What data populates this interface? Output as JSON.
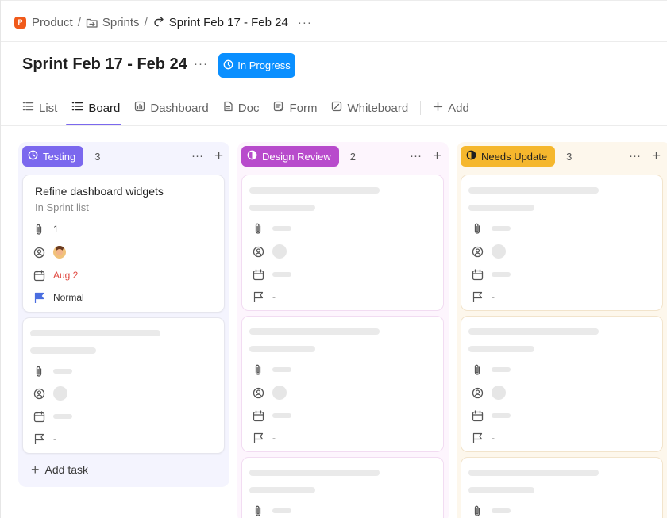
{
  "breadcrumb": {
    "badge": "P",
    "items": [
      "Product",
      "Sprints",
      "Sprint Feb 17 - Feb 24"
    ],
    "separator": "/",
    "more": "···"
  },
  "header": {
    "title": "Sprint Feb 17 - Feb 24",
    "more": "···",
    "status": "In Progress",
    "status_color": "#0a8fff"
  },
  "tabs": [
    {
      "label": "List",
      "icon": "list-icon",
      "active": false
    },
    {
      "label": "Board",
      "icon": "board-icon",
      "active": true
    },
    {
      "label": "Dashboard",
      "icon": "dashboard-icon",
      "active": false
    },
    {
      "label": "Doc",
      "icon": "doc-icon",
      "active": false
    },
    {
      "label": "Form",
      "icon": "form-icon",
      "active": false
    },
    {
      "label": "Whiteboard",
      "icon": "whiteboard-icon",
      "active": false
    }
  ],
  "add_view_label": "Add",
  "columns": [
    {
      "name": "Testing",
      "count": "3",
      "color": "#7b68ee"
    },
    {
      "name": "Design Review",
      "count": "2",
      "color": "#b84bcc"
    },
    {
      "name": "Needs Update",
      "count": "3",
      "color": "#f5b72d"
    }
  ],
  "task": {
    "title": "Refine dashboard widgets",
    "list": "In Sprint list",
    "attachments": "1",
    "due_date": "Aug 2",
    "priority": "Normal",
    "priority_color": "#4a6ee0"
  },
  "placeholder_dash": "-",
  "add_task_label": "Add task"
}
